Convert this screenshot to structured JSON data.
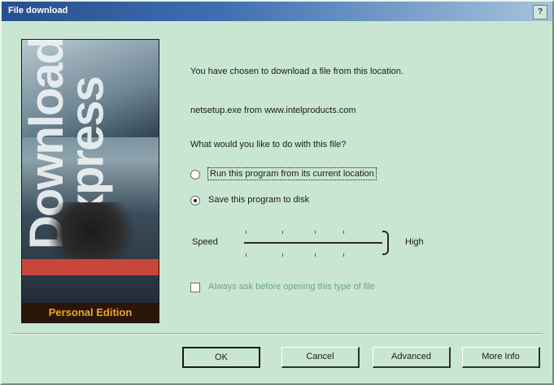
{
  "window": {
    "title": "File download",
    "help_glyph": "?"
  },
  "boxart": {
    "side_title": "Download Express",
    "edition": "Personal Edition"
  },
  "message": {
    "line1": "You have chosen to download a file from this location.",
    "line2": "netsetup.exe from www.intelproducts.com",
    "question": "What would you like to do with this file?"
  },
  "options": [
    {
      "label": "Run this program from its current location",
      "selected": false
    },
    {
      "label": "Save this program to disk",
      "selected": true
    }
  ],
  "speed": {
    "low_label": "Speed",
    "high_label": "High",
    "level": 1.0
  },
  "checkbox": {
    "label": "Always ask before opening this type of file",
    "checked": false
  },
  "buttons": {
    "ok": "OK",
    "cancel": "Cancel",
    "advanced": "Advanced",
    "more_info": "More Info"
  }
}
